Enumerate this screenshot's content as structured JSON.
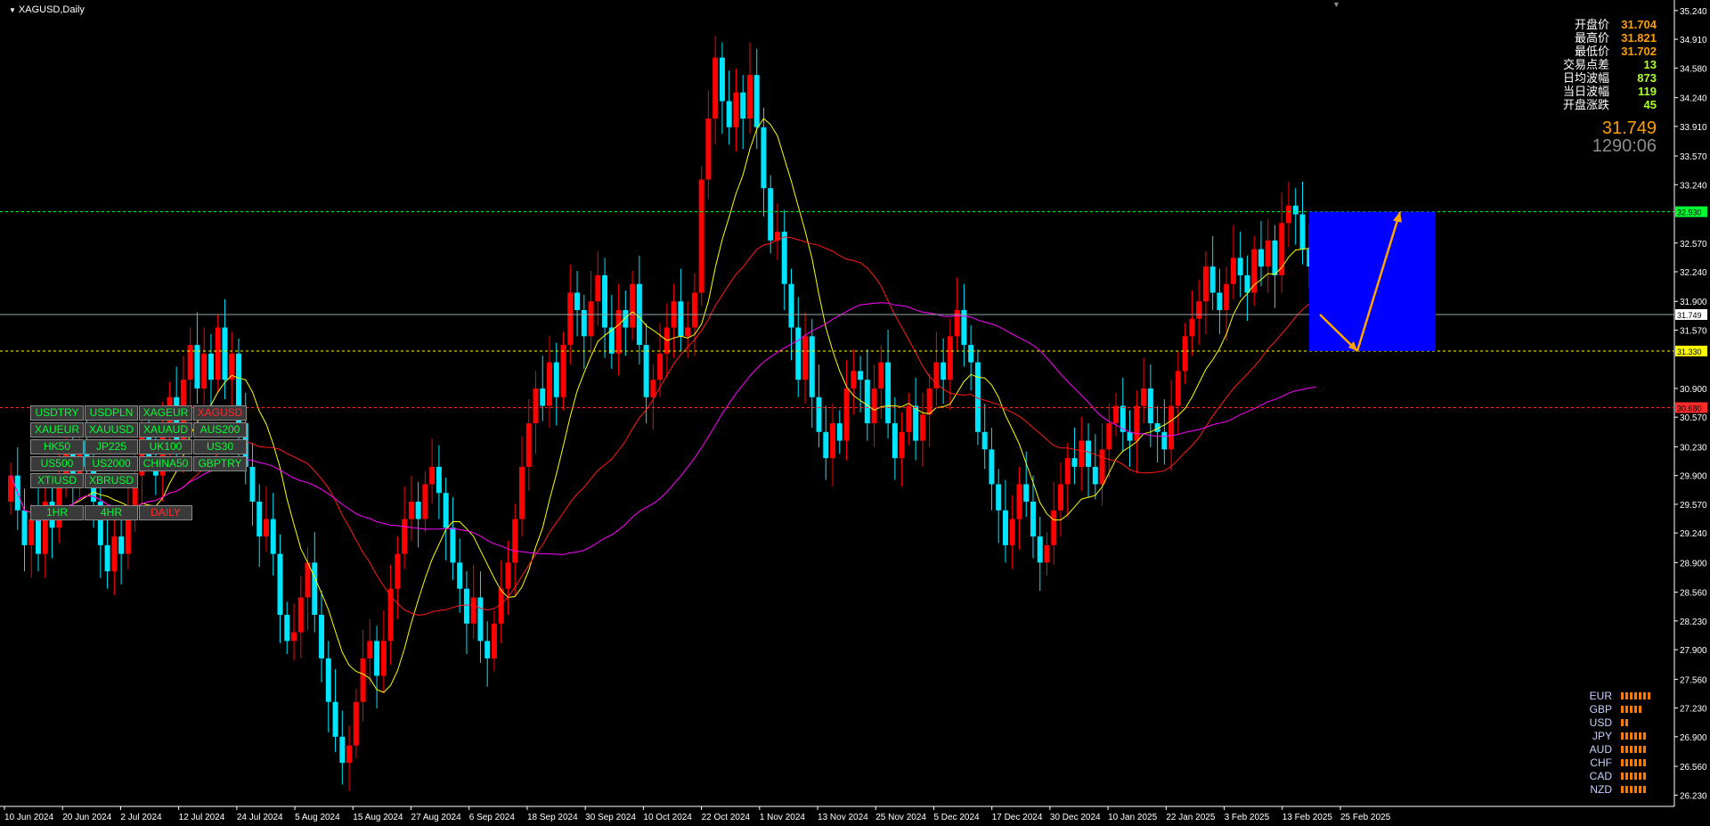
{
  "window": {
    "title": "XAGUSD,Daily"
  },
  "info_panel": [
    {
      "label": "开盘价",
      "value": "31.704",
      "color": "#ff9f00"
    },
    {
      "label": "最高价",
      "value": "31.821",
      "color": "#ff9f00"
    },
    {
      "label": "最低价",
      "value": "31.702",
      "color": "#ff9f00"
    },
    {
      "label": "交易点差",
      "value": "13",
      "color": "#adff2f"
    },
    {
      "label": "日均波幅",
      "value": "873",
      "color": "#adff2f"
    },
    {
      "label": "当日波幅",
      "value": "119",
      "color": "#adff2f"
    },
    {
      "label": "开盘涨跌",
      "value": "45",
      "color": "#adff2f"
    }
  ],
  "current_price": "31.749",
  "countdown": "1290:06",
  "symbol_buttons": [
    {
      "label": "USDTRY",
      "active": false
    },
    {
      "label": "USDPLN",
      "active": false
    },
    {
      "label": "XAGEUR",
      "active": false
    },
    {
      "label": "XAGUSD",
      "active": true
    },
    {
      "label": "XAUEUR",
      "active": false
    },
    {
      "label": "XAUUSD",
      "active": false
    },
    {
      "label": "XAUAUD",
      "active": false
    },
    {
      "label": "AUS200",
      "active": false
    },
    {
      "label": "HK50",
      "active": false
    },
    {
      "label": "JP225",
      "active": false
    },
    {
      "label": "UK100",
      "active": false
    },
    {
      "label": "US30",
      "active": false
    },
    {
      "label": "US500",
      "active": false
    },
    {
      "label": "US2000",
      "active": false
    },
    {
      "label": "CHINA50",
      "active": false
    },
    {
      "label": "GBPTRY",
      "active": false
    },
    {
      "label": "XTIUSD",
      "active": false
    },
    {
      "label": "XBRUSD",
      "active": false
    }
  ],
  "timeframe_buttons": [
    {
      "label": "1HR",
      "active": false
    },
    {
      "label": "4HR",
      "active": false
    },
    {
      "label": "DAILY",
      "active": true
    }
  ],
  "currency_strength": [
    {
      "currency": "EUR",
      "bars": 7
    },
    {
      "currency": "GBP",
      "bars": 5
    },
    {
      "currency": "USD",
      "bars": 2
    },
    {
      "currency": "JPY",
      "bars": 6
    },
    {
      "currency": "AUD",
      "bars": 6
    },
    {
      "currency": "CHF",
      "bars": 6
    },
    {
      "currency": "CAD",
      "bars": 6
    },
    {
      "currency": "NZD",
      "bars": 6
    }
  ],
  "colors": {
    "bull": "#ff0000",
    "bear": "#00e5ff",
    "ma_fast": "#ffff00",
    "ma_mid": "#ff1a1a",
    "ma_slow": "#ff00ff",
    "grid_axis": "#ffffff",
    "green_level": "#00ff32",
    "yellow_level": "#ffff00",
    "red_level": "#ff2a2a",
    "forecast_box": "#0000ff",
    "forecast_arrow": "#ffa500"
  },
  "chart_data": {
    "type": "candlestick",
    "symbol": "XAGUSD",
    "timeframe": "Daily",
    "y_ticks": [
      "35.240",
      "34.910",
      "34.580",
      "34.240",
      "33.910",
      "33.570",
      "33.240",
      "32.570",
      "32.240",
      "31.900",
      "31.570",
      "30.900",
      "30.570",
      "30.230",
      "29.900",
      "29.570",
      "29.240",
      "28.900",
      "28.560",
      "28.230",
      "27.900",
      "27.560",
      "27.230",
      "26.900",
      "26.560",
      "26.230"
    ],
    "x_ticks": [
      "10 Jun 2024",
      "20 Jun 2024",
      "2 Jul 2024",
      "12 Jul 2024",
      "24 Jul 2024",
      "5 Aug 2024",
      "15 Aug 2024",
      "27 Aug 2024",
      "6 Sep 2024",
      "18 Sep 2024",
      "30 Sep 2024",
      "10 Oct 2024",
      "22 Oct 2024",
      "1 Nov 2024",
      "13 Nov 2024",
      "25 Nov 2024",
      "5 Dec 2024",
      "17 Dec 2024",
      "30 Dec 2024",
      "10 Jan 2025",
      "22 Jan 2025",
      "3 Feb 2025",
      "13 Feb 2025",
      "25 Feb 2025"
    ],
    "ylim": [
      26.1,
      35.3
    ],
    "price_levels": [
      {
        "value": 32.93,
        "label": "32.930",
        "color": "#00ff32"
      },
      {
        "value": 31.749,
        "label": "31.749",
        "color": "#ffffff"
      },
      {
        "value": 31.33,
        "label": "31.330",
        "color": "#ffff00"
      },
      {
        "value": 30.68,
        "label": "30.680",
        "color": "#ff2a2a"
      }
    ],
    "closes": [
      29.9,
      29.5,
      29.1,
      29.4,
      29.0,
      29.6,
      29.3,
      29.9,
      30.2,
      29.8,
      30.3,
      30.0,
      29.6,
      29.1,
      28.8,
      29.2,
      29.0,
      29.5,
      29.9,
      30.4,
      30.1,
      29.9,
      30.5,
      30.8,
      30.2,
      31.0,
      31.4,
      30.9,
      31.3,
      31.0,
      31.6,
      31.0,
      31.3,
      30.5,
      30.0,
      29.6,
      29.2,
      29.4,
      29.0,
      28.3,
      28.0,
      28.1,
      28.5,
      28.9,
      28.3,
      27.8,
      27.3,
      26.9,
      26.6,
      26.8,
      27.3,
      27.8,
      28.0,
      27.6,
      28.0,
      28.6,
      29.0,
      29.4,
      29.6,
      29.4,
      29.8,
      30.0,
      29.7,
      29.3,
      28.9,
      28.6,
      28.2,
      28.5,
      28.0,
      27.8,
      28.2,
      28.6,
      28.9,
      29.4,
      30.0,
      30.5,
      30.9,
      30.7,
      31.2,
      30.8,
      31.4,
      32.0,
      31.8,
      31.5,
      31.9,
      32.2,
      31.6,
      31.3,
      31.8,
      31.6,
      32.1,
      31.4,
      30.8,
      31.0,
      31.3,
      31.6,
      31.9,
      31.5,
      31.6,
      32.0,
      33.3,
      34.0,
      34.7,
      34.2,
      33.9,
      34.3,
      34.0,
      34.5,
      33.9,
      33.2,
      32.6,
      32.7,
      32.1,
      31.6,
      31.0,
      31.5,
      30.8,
      30.4,
      30.1,
      30.5,
      30.3,
      30.9,
      31.1,
      31.0,
      30.5,
      30.9,
      31.2,
      30.5,
      30.1,
      30.4,
      30.7,
      30.3,
      30.6,
      30.9,
      31.2,
      31.0,
      31.5,
      31.8,
      31.4,
      31.2,
      30.4,
      30.2,
      29.8,
      29.5,
      29.1,
      29.4,
      29.8,
      29.6,
      29.2,
      28.9,
      29.1,
      29.5,
      29.8,
      30.1,
      30.0,
      30.3,
      30.0,
      29.8,
      30.2,
      30.5,
      30.7,
      30.4,
      30.3,
      30.7,
      30.9,
      30.5,
      30.4,
      30.2,
      30.7,
      31.1,
      31.5,
      31.7,
      31.9,
      32.3,
      32.0,
      31.8,
      32.1,
      32.4,
      32.2,
      32.0,
      32.5,
      32.3,
      32.6,
      32.2,
      32.8,
      33.0,
      32.9,
      32.5,
      32.3,
      31.75
    ],
    "ma_fast_label": "yellow MA",
    "forecast": {
      "from": 31.749,
      "dip_to": 31.33,
      "target": 32.93
    }
  }
}
